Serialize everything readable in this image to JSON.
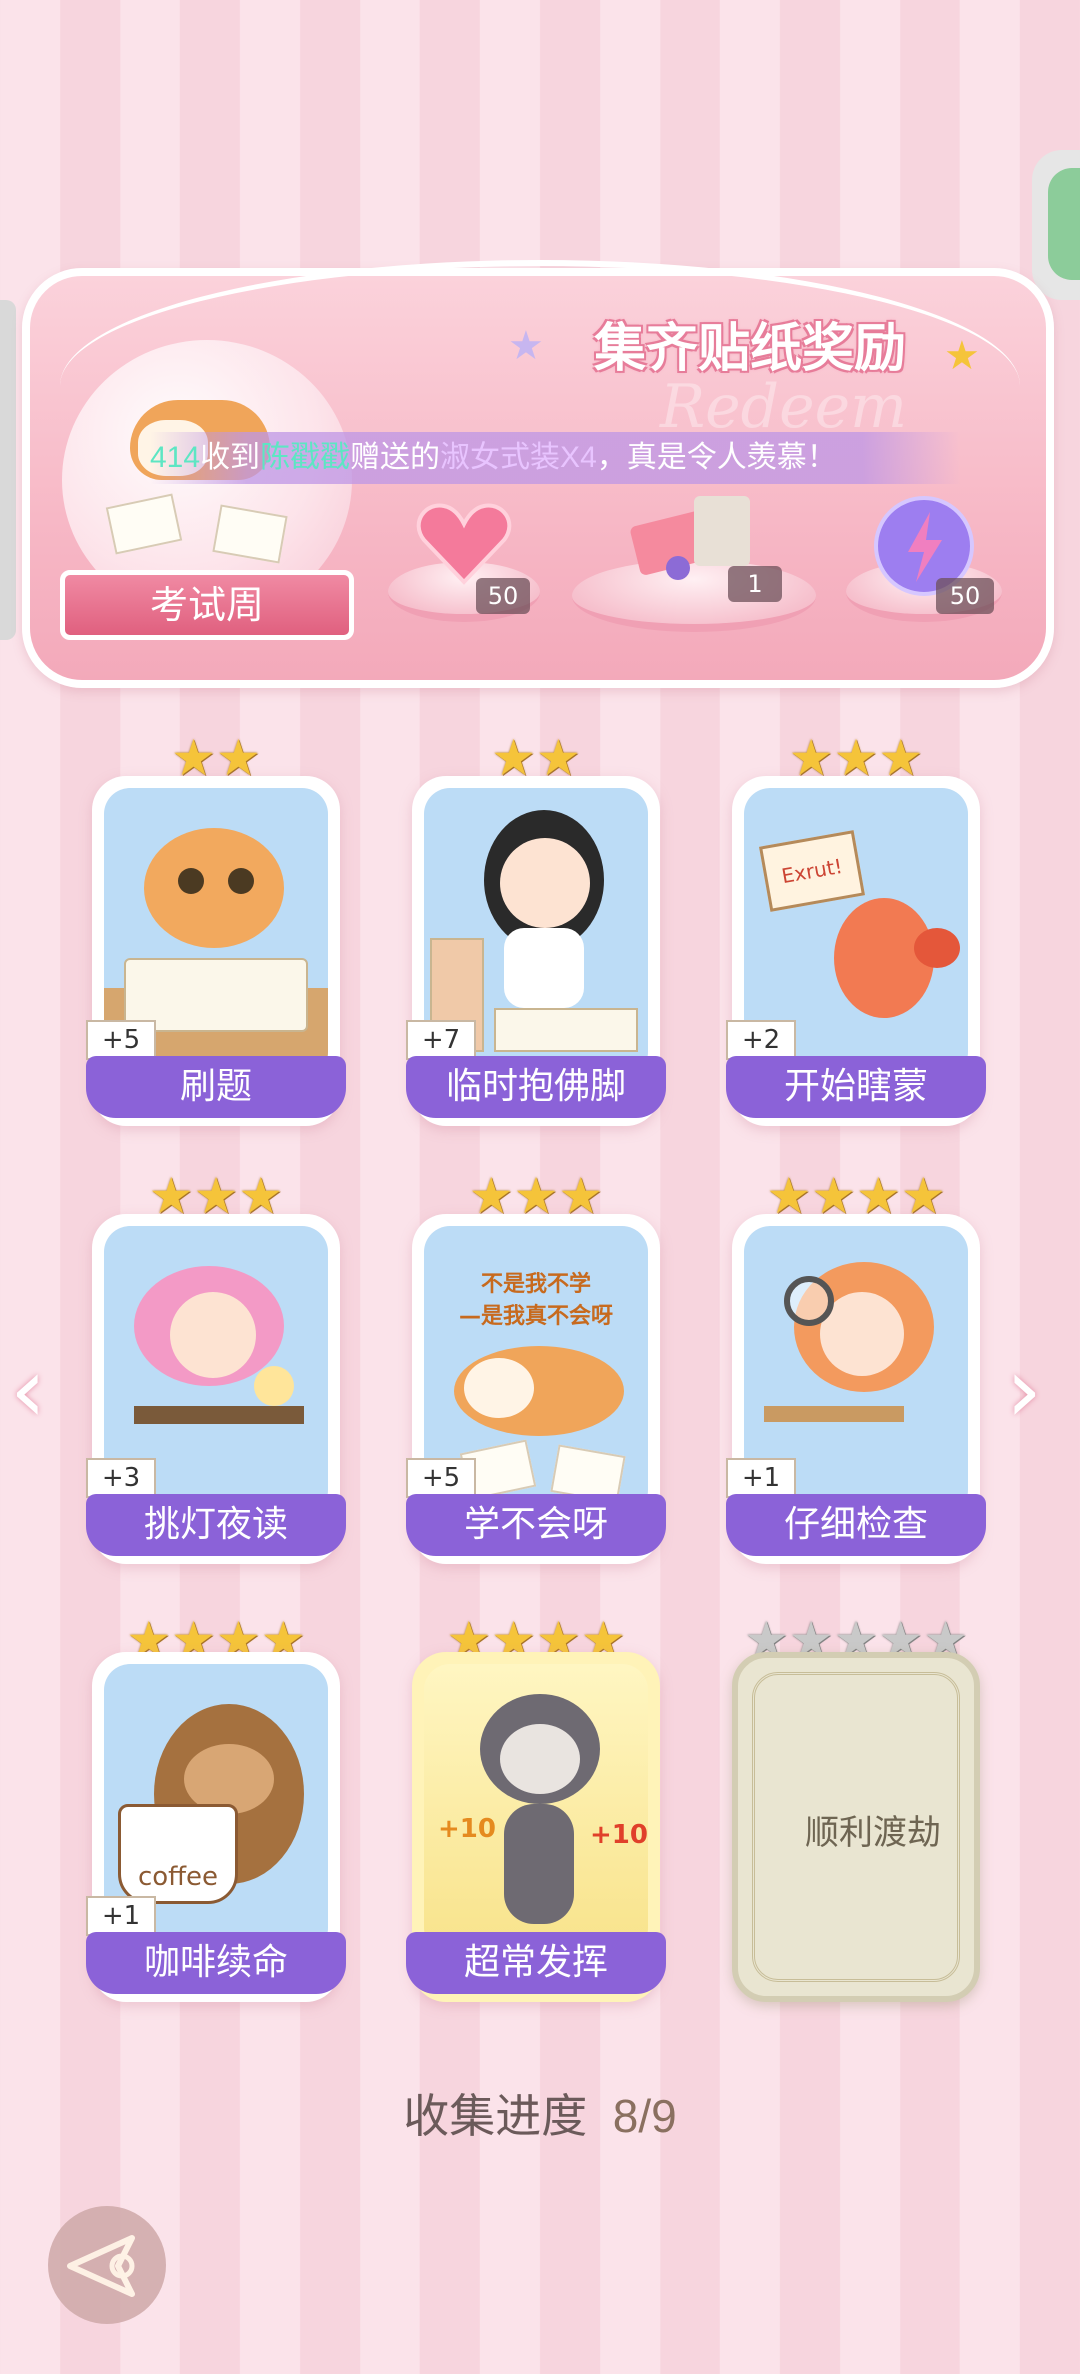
{
  "panel": {
    "title": "集齐贴纸奖励",
    "ghost_text": "Redeem",
    "theme_label": "考试周",
    "rewards": [
      {
        "icon": "pink-heart-gem-icon",
        "count": "50"
      },
      {
        "icon": "gift-box-bundle-icon",
        "count": "1"
      },
      {
        "icon": "purple-lightning-orb-icon",
        "count": "50"
      }
    ]
  },
  "marquee": {
    "prefix": "414",
    "mid1": "收到",
    "sender": "陈戳戳",
    "mid2": "赠送的",
    "item": "淑女式装X4",
    "suffix": "，真是令人羡慕！"
  },
  "cards": [
    {
      "label": "刷题",
      "bonus": "+5",
      "stars": "★★"
    },
    {
      "label": "临时抱佛脚",
      "bonus": "+7",
      "stars": "★★"
    },
    {
      "label": "开始瞎蒙",
      "bonus": "+2",
      "stars": "★★★",
      "sign": "Exrut!"
    },
    {
      "label": "挑灯夜读",
      "bonus": "+3",
      "stars": "★★★"
    },
    {
      "label": "学不会呀",
      "bonus": "+5",
      "stars": "★★★",
      "caption1": "不是我不学",
      "caption2": "—是我真不会呀"
    },
    {
      "label": "仔细检查",
      "bonus": "+1",
      "stars": "★★★★"
    },
    {
      "label": "咖啡续命",
      "bonus": "+1",
      "stars": "★★★★",
      "cup": "coffee"
    },
    {
      "label": "超常发挥",
      "stars": "★★★★",
      "plus": "+10"
    },
    {
      "label": "顺利渡劫",
      "stars": "★★★★★",
      "locked": true
    }
  ],
  "progress": {
    "label": "收集进度",
    "value": "8/9"
  },
  "colors": {
    "accent": "#8b62d8",
    "background": "#fbe3ea",
    "star": "#f5c43a"
  }
}
